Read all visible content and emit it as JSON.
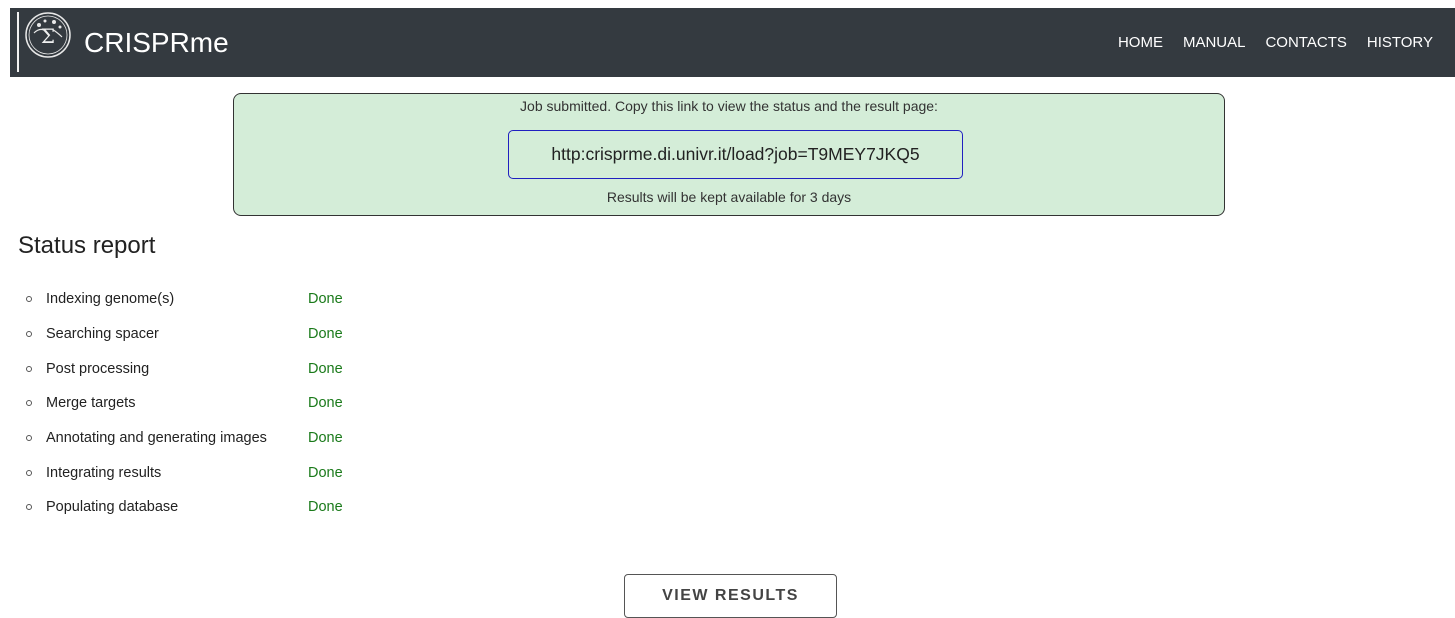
{
  "header": {
    "brand": "CRISPRme",
    "nav": [
      "HOME",
      "MANUAL",
      "CONTACTS",
      "HISTORY"
    ]
  },
  "job": {
    "submitted_text": "Job submitted. Copy this link to view the status and the result page:",
    "link": "http:crisprme.di.univr.it/load?job=T9MEY7JKQ5",
    "retention_text": "Results will be kept available for 3 days"
  },
  "status": {
    "title": "Status report",
    "steps": [
      {
        "label": "Indexing genome(s)",
        "status": "Done"
      },
      {
        "label": "Searching spacer",
        "status": "Done"
      },
      {
        "label": "Post processing",
        "status": "Done"
      },
      {
        "label": "Merge targets",
        "status": "Done"
      },
      {
        "label": "Annotating and generating images",
        "status": "Done"
      },
      {
        "label": "Integrating results",
        "status": "Done"
      },
      {
        "label": "Populating database",
        "status": "Done"
      }
    ]
  },
  "actions": {
    "view_results": "VIEW RESULTS"
  },
  "colors": {
    "navbar": "#343a40",
    "job_box_bg": "#d4edd8",
    "link_border": "#2020c0",
    "done": "#1a7a1a"
  }
}
